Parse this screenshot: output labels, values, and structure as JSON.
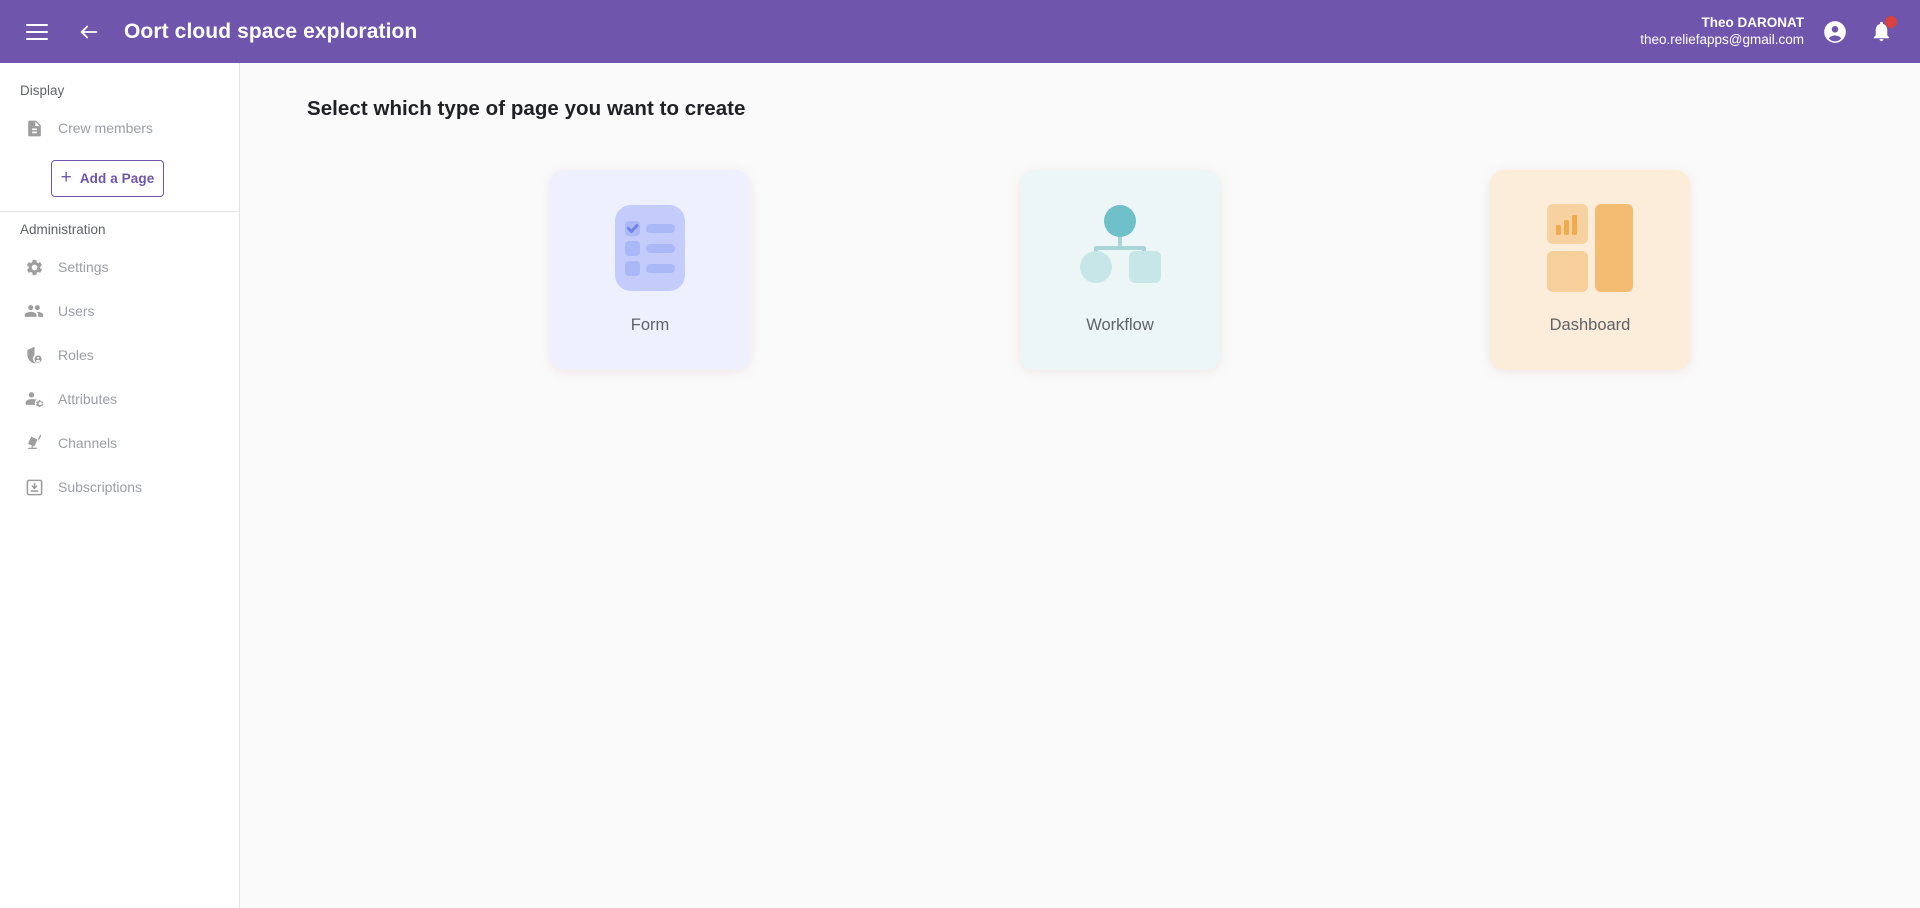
{
  "header": {
    "menu_icon": "hamburger-menu-icon",
    "back_icon": "arrow-left-icon",
    "title": "Oort cloud space exploration",
    "user_name": "Theo DARONAT",
    "user_email": "theo.reliefapps@gmail.com",
    "account_icon": "account-circle-icon",
    "notifications_icon": "bell-icon",
    "has_notification_badge": true,
    "background_color": "#6f55ab",
    "text_color": "#ffffff",
    "badge_color": "#d94040"
  },
  "sidebar": {
    "sections": [
      {
        "title": "Display",
        "items": [
          {
            "label": "Crew members",
            "icon": "document-icon"
          }
        ],
        "action": {
          "label": "Add a Page",
          "icon": "plus-icon",
          "color": "#6f55ab"
        }
      },
      {
        "title": "Administration",
        "items": [
          {
            "label": "Settings",
            "icon": "gear-icon"
          },
          {
            "label": "Users",
            "icon": "people-icon"
          },
          {
            "label": "Roles",
            "icon": "shield-person-icon"
          },
          {
            "label": "Attributes",
            "icon": "person-gear-icon"
          },
          {
            "label": "Channels",
            "icon": "channel-broadcast-icon"
          },
          {
            "label": "Subscriptions",
            "icon": "inbox-download-icon"
          }
        ]
      }
    ]
  },
  "main": {
    "heading": "Select which type of page you want to create",
    "cards": [
      {
        "label": "Form",
        "icon": "form-checklist-icon",
        "background_color": "#eef1fd",
        "accent_color": "#b9c5f7"
      },
      {
        "label": "Workflow",
        "icon": "workflow-hierarchy-icon",
        "background_color": "#edf6f7",
        "accent_color": "#7ec7ce"
      },
      {
        "label": "Dashboard",
        "icon": "dashboard-tiles-icon",
        "background_color": "#fcedda",
        "accent_color": "#f3bf79"
      }
    ]
  }
}
